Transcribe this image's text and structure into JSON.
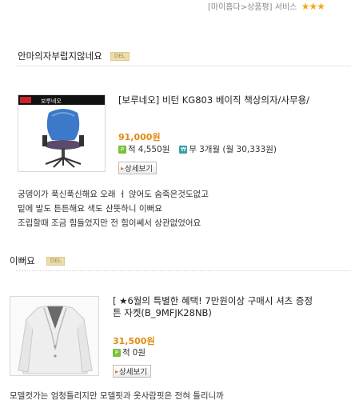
{
  "topbar": {
    "breadcrumb": "[마이홈다>상품평]",
    "service_label": "서비스",
    "rating_stars": "★★★"
  },
  "reviews": [
    {
      "title": "안마의자부럽지않네요",
      "del_label": "DEL",
      "product": {
        "brand_label": "보루네오",
        "title_line1": "[보루네오] 비턴 KG803 베이직 책상의자/사무용/",
        "price": "91,000원",
        "points_label": "적",
        "points": "4,550원",
        "installment_label": "무",
        "installment": "3개월 (월 30,333원)",
        "detail_button": "상세보기"
      },
      "body": [
        "궁뎅이가 푹신푹신해요 오래 ㅓ 앉어도 숨죽은것도없고",
        "밑에 발도 튼튼해요 색도 산뜻하니 이뻐요",
        "조립할때 조금 힘들었지만 전 힘이쎄서 상관없었어요"
      ]
    },
    {
      "title": "이뻐요",
      "del_label": "DEL",
      "product": {
        "title_line1": "[ ★6월의 특별한 혜택! 7만원이상 구매시 셔츠 증정",
        "title_line2": "튼 자켓(B_9MFJK28NB)",
        "price": "31,500원",
        "points_label": "적",
        "points": "0원",
        "detail_button": "상세보기"
      },
      "body": [
        "모델컷가는 엄청틀리지만 모델핏과 옷사람핏은 전혀 틀리니까"
      ]
    }
  ],
  "colors": {
    "price": "#e28a10",
    "accent_orange": "#f3a71a",
    "del_badge_bg": "#ecdcae",
    "points_icon": "#7bbf3b",
    "free_icon": "#3aa0a8"
  }
}
